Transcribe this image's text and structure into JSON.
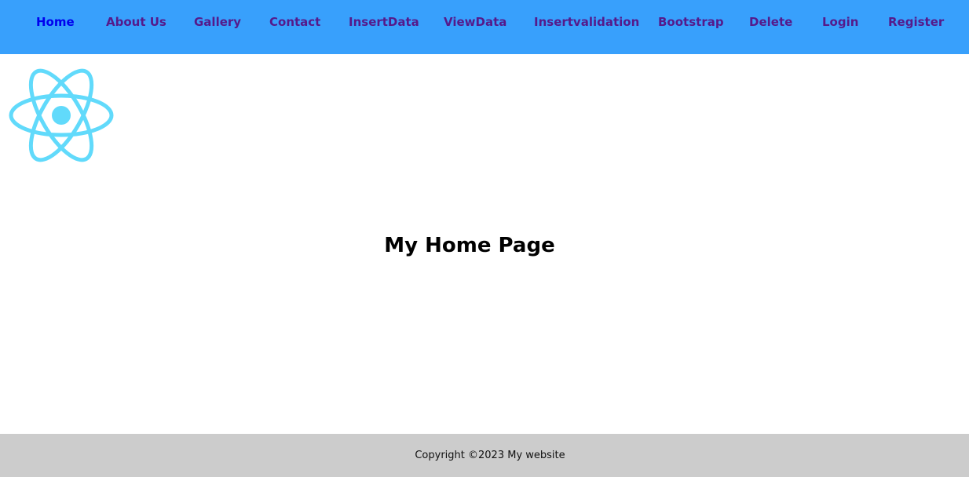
{
  "nav": {
    "items": [
      {
        "label": "Home"
      },
      {
        "label": "About Us"
      },
      {
        "label": "Gallery"
      },
      {
        "label": "Contact"
      },
      {
        "label": "InsertData"
      },
      {
        "label": "ViewData"
      },
      {
        "label": "Insertvalidation"
      },
      {
        "label": "Bootstrap"
      },
      {
        "label": "Delete"
      },
      {
        "label": "Login"
      },
      {
        "label": "Register"
      }
    ]
  },
  "main": {
    "title": "My Home Page",
    "logo_icon": "react-logo-icon"
  },
  "footer": {
    "text": "Copyright ©2023 My website"
  },
  "colors": {
    "navbar": "#38a0fc",
    "link_active": "#0000ee",
    "link_visited": "#551a8b",
    "logo": "#61dafb",
    "footer": "#cccccc"
  }
}
